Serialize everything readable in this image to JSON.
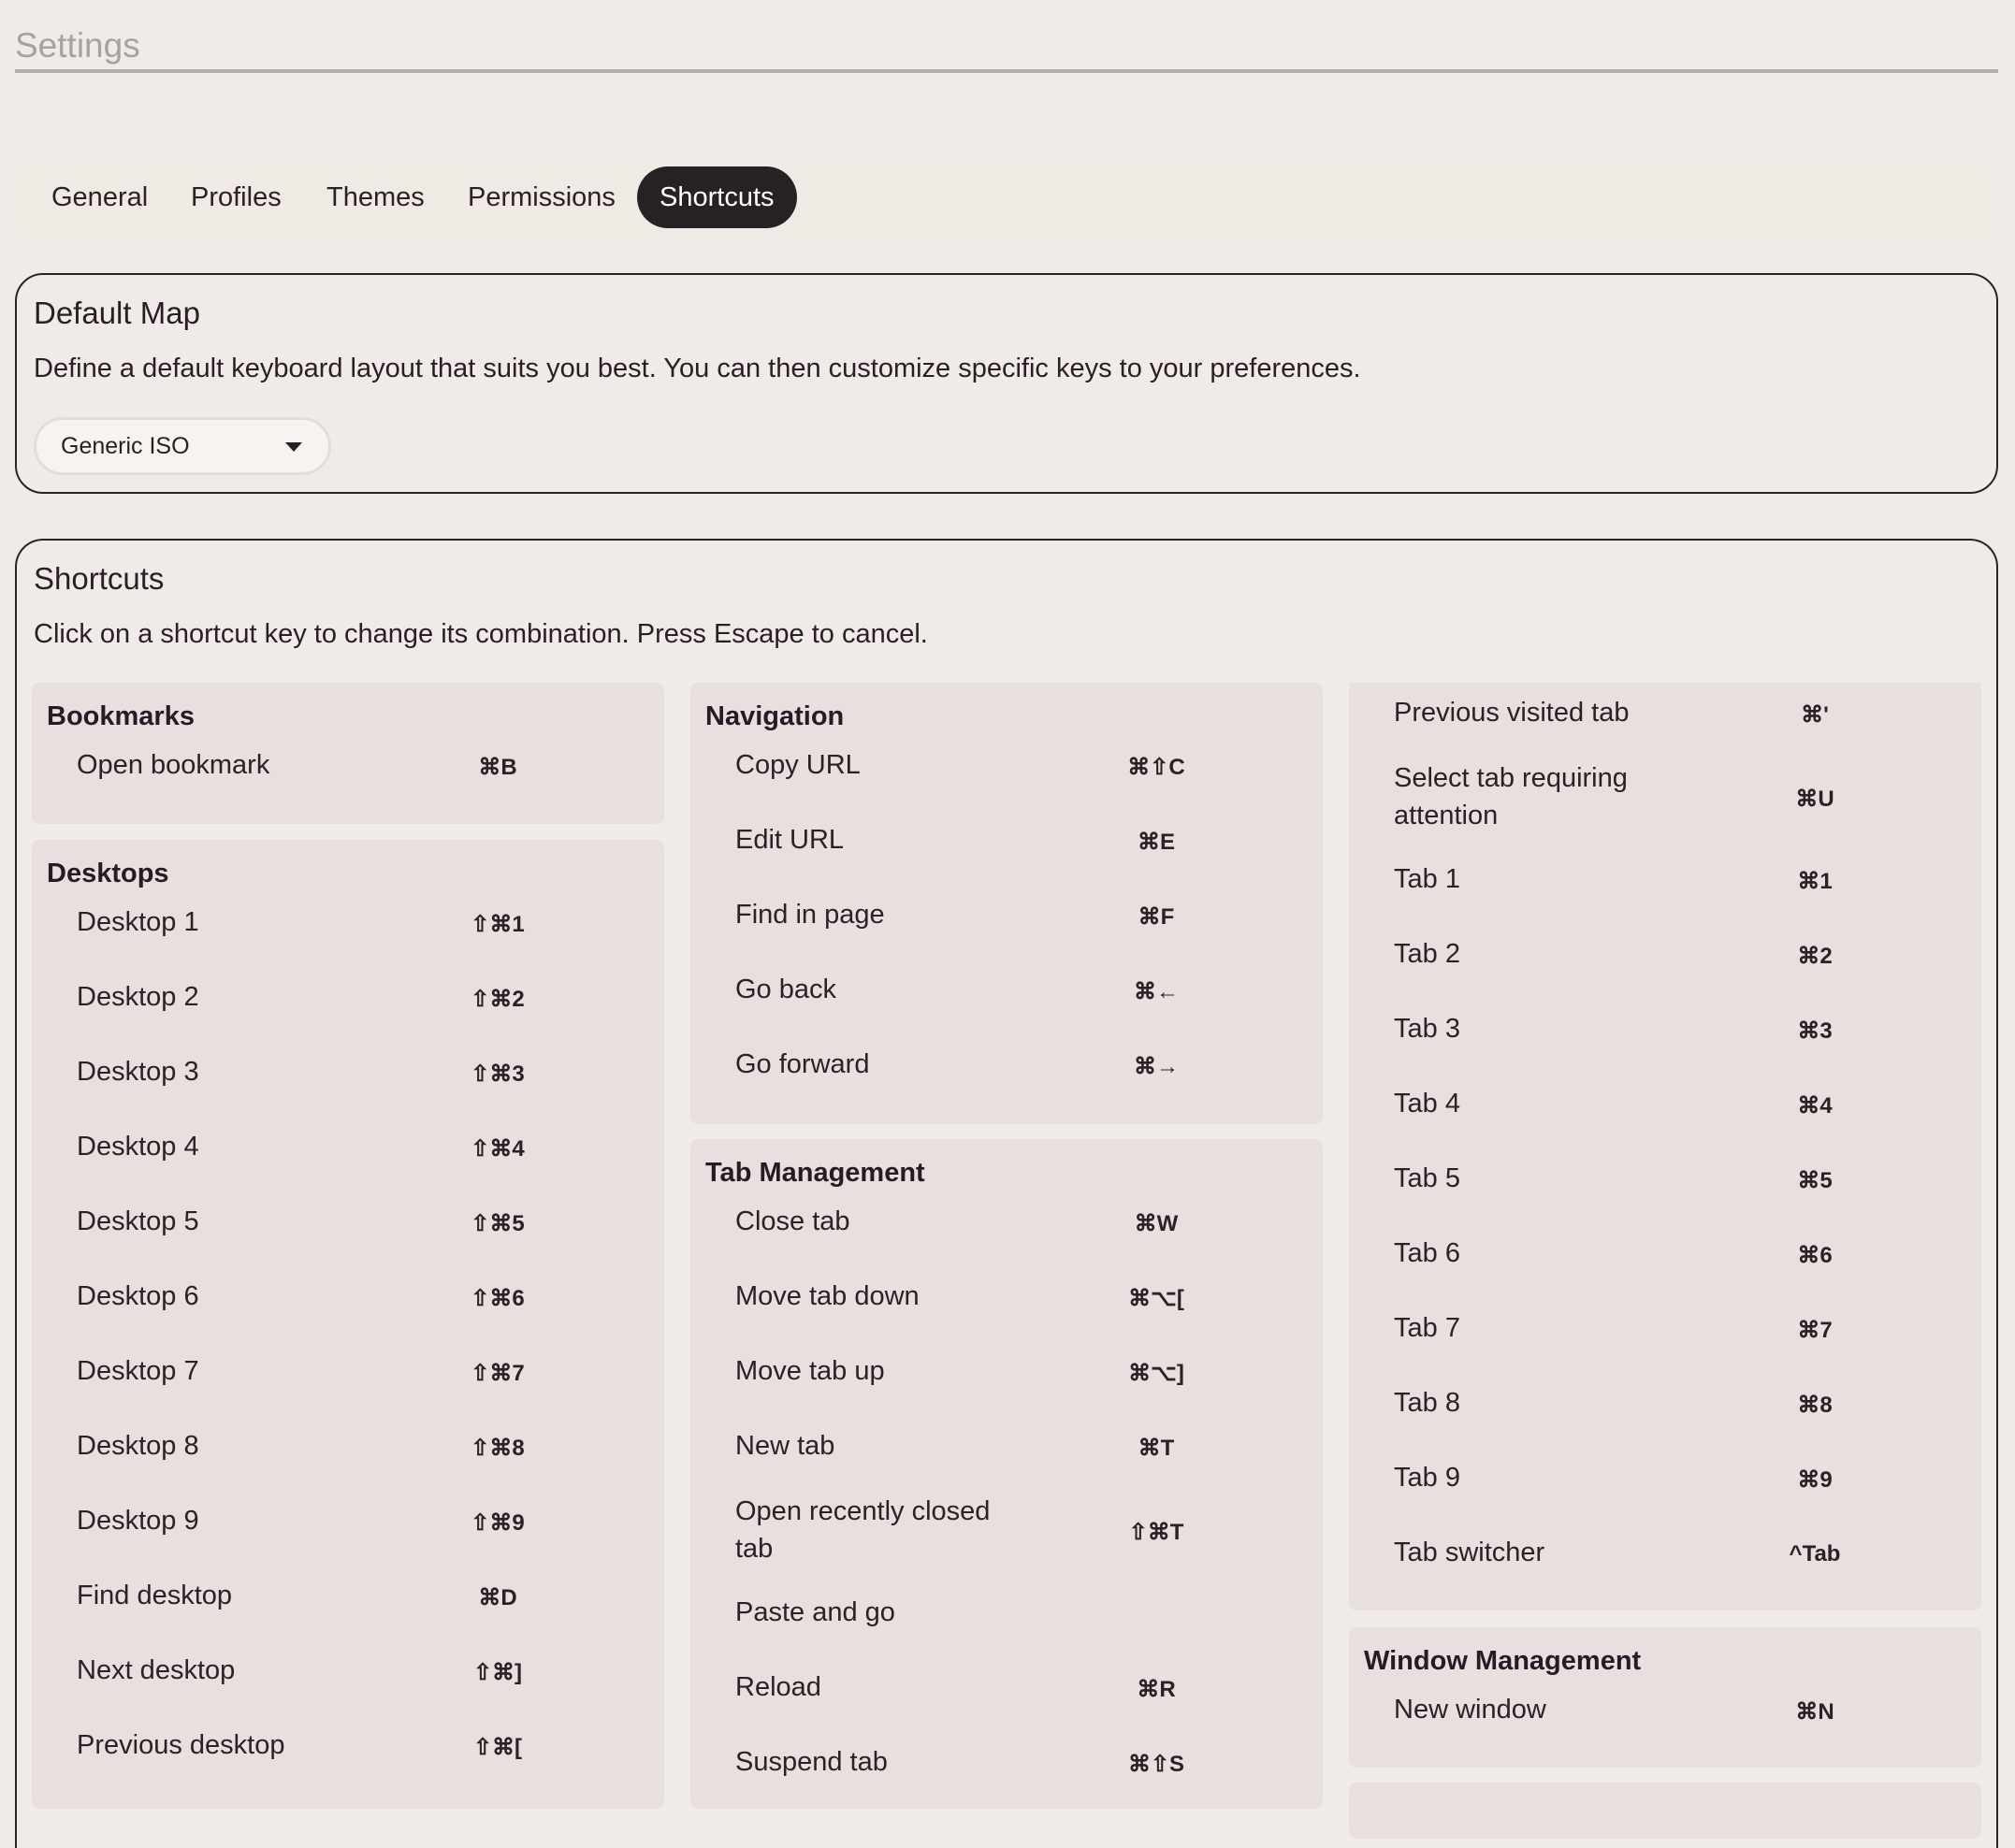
{
  "settings_title": "Settings",
  "tabs": [
    {
      "label": "General"
    },
    {
      "label": "Profiles"
    },
    {
      "label": "Themes"
    },
    {
      "label": "Permissions"
    },
    {
      "label": "Shortcuts"
    }
  ],
  "default_map": {
    "title": "Default Map",
    "description": "Define a default keyboard layout that suits you best. You can then customize specific keys to your preferences.",
    "selected": "Generic ISO"
  },
  "shortcuts": {
    "title": "Shortcuts",
    "description": "Click on a shortcut key to change its combination. Press Escape to cancel.",
    "bookmarks": {
      "title": "Bookmarks",
      "rows": [
        {
          "label": "Open bookmark",
          "key": "⌘B"
        }
      ]
    },
    "desktops": {
      "title": "Desktops",
      "rows": [
        {
          "label": "Desktop 1",
          "key": "⇧⌘1"
        },
        {
          "label": "Desktop 2",
          "key": "⇧⌘2"
        },
        {
          "label": "Desktop 3",
          "key": "⇧⌘3"
        },
        {
          "label": "Desktop 4",
          "key": "⇧⌘4"
        },
        {
          "label": "Desktop 5",
          "key": "⇧⌘5"
        },
        {
          "label": "Desktop 6",
          "key": "⇧⌘6"
        },
        {
          "label": "Desktop 7",
          "key": "⇧⌘7"
        },
        {
          "label": "Desktop 8",
          "key": "⇧⌘8"
        },
        {
          "label": "Desktop 9",
          "key": "⇧⌘9"
        },
        {
          "label": "Find desktop",
          "key": "⌘D"
        },
        {
          "label": "Next desktop",
          "key": "⇧⌘]"
        },
        {
          "label": "Previous desktop",
          "key": "⇧⌘["
        }
      ]
    },
    "navigation": {
      "title": "Navigation",
      "rows": [
        {
          "label": "Copy URL",
          "key": "⌘⇧C"
        },
        {
          "label": "Edit URL",
          "key": "⌘E"
        },
        {
          "label": "Find in page",
          "key": "⌘F"
        },
        {
          "label": "Go back",
          "key": "⌘←"
        },
        {
          "label": "Go forward",
          "key": "⌘→"
        }
      ]
    },
    "tab_management": {
      "title": "Tab Management",
      "rows": [
        {
          "label": "Close tab",
          "key": "⌘W"
        },
        {
          "label": "Move tab down",
          "key": "⌘⌥["
        },
        {
          "label": "Move tab up",
          "key": "⌘⌥]"
        },
        {
          "label": "New tab",
          "key": "⌘T"
        },
        {
          "label": "Open recently closed tab",
          "line1": "Open recently closed",
          "line2": "tab",
          "key": "⇧⌘T"
        },
        {
          "label": "Paste and go",
          "key": ""
        },
        {
          "label": "Reload",
          "key": "⌘R"
        },
        {
          "label": "Suspend tab",
          "key": "⌘⇧S"
        }
      ]
    },
    "tabs_cont": {
      "rows": [
        {
          "label": "Previous visited tab",
          "key": "⌘'"
        },
        {
          "label": "Select tab requiring attention",
          "line1": "Select tab requiring",
          "line2": "attention",
          "key": "⌘U"
        },
        {
          "label": "Tab 1",
          "key": "⌘1"
        },
        {
          "label": "Tab 2",
          "key": "⌘2"
        },
        {
          "label": "Tab 3",
          "key": "⌘3"
        },
        {
          "label": "Tab 4",
          "key": "⌘4"
        },
        {
          "label": "Tab 5",
          "key": "⌘5"
        },
        {
          "label": "Tab 6",
          "key": "⌘6"
        },
        {
          "label": "Tab 7",
          "key": "⌘7"
        },
        {
          "label": "Tab 8",
          "key": "⌘8"
        },
        {
          "label": "Tab 9",
          "key": "⌘9"
        },
        {
          "label": "Tab switcher",
          "key": "^Tab"
        }
      ]
    },
    "window_management": {
      "title": "Window Management",
      "rows": [
        {
          "label": "New window",
          "key": "⌘N"
        }
      ]
    }
  }
}
